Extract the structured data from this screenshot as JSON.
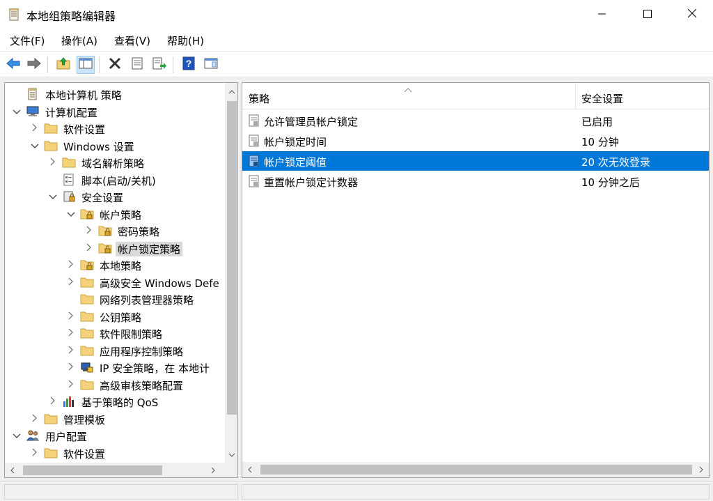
{
  "window": {
    "title": "本地组策略编辑器",
    "controls": {
      "minimize": "minimize-icon",
      "maximize": "maximize-icon",
      "close": "close-icon"
    }
  },
  "menu": [
    "文件(F)",
    "操作(A)",
    "查看(V)",
    "帮助(H)"
  ],
  "toolbar": {
    "icons": [
      "back-arrow-icon",
      "forward-arrow-icon",
      "up-folder-icon",
      "show-hide-tree-icon",
      "delete-icon",
      "properties-icon",
      "export-list-icon",
      "help-icon",
      "console-view-icon"
    ]
  },
  "tree": {
    "items": [
      {
        "label": "本地计算机 策略",
        "icon": "policy-document-icon",
        "expander": "none"
      },
      {
        "label": "计算机配置",
        "icon": "computer-icon",
        "expander": "expanded"
      },
      {
        "label": "软件设置",
        "icon": "folder-icon",
        "expander": "collapsed"
      },
      {
        "label": "Windows 设置",
        "icon": "folder-icon",
        "expander": "expanded"
      },
      {
        "label": "域名解析策略",
        "icon": "folder-icon",
        "expander": "collapsed"
      },
      {
        "label": "脚本(启动/关机)",
        "icon": "script-icon",
        "expander": "none"
      },
      {
        "label": "安全设置",
        "icon": "security-settings-icon",
        "expander": "expanded"
      },
      {
        "label": "帐户策略",
        "icon": "locked-folder-icon",
        "expander": "expanded"
      },
      {
        "label": "密码策略",
        "icon": "locked-folder-icon",
        "expander": "collapsed"
      },
      {
        "label": "帐户锁定策略",
        "icon": "locked-folder-icon",
        "expander": "collapsed",
        "selected": true
      },
      {
        "label": "本地策略",
        "icon": "locked-folder-icon",
        "expander": "collapsed"
      },
      {
        "label": "高级安全 Windows Defe",
        "icon": "folder-icon",
        "expander": "collapsed"
      },
      {
        "label": "网络列表管理器策略",
        "icon": "folder-icon",
        "expander": "none"
      },
      {
        "label": "公钥策略",
        "icon": "folder-icon",
        "expander": "collapsed"
      },
      {
        "label": "软件限制策略",
        "icon": "folder-icon",
        "expander": "collapsed"
      },
      {
        "label": "应用程序控制策略",
        "icon": "folder-icon",
        "expander": "collapsed"
      },
      {
        "label": "IP 安全策略，在 本地计",
        "icon": "ip-security-icon",
        "expander": "collapsed"
      },
      {
        "label": "高级审核策略配置",
        "icon": "folder-icon",
        "expander": "collapsed"
      },
      {
        "label": "基于策略的 QoS",
        "icon": "qos-chart-icon",
        "expander": "collapsed"
      },
      {
        "label": "管理模板",
        "icon": "folder-icon",
        "expander": "collapsed"
      },
      {
        "label": "用户配置",
        "icon": "user-icon",
        "expander": "expanded"
      },
      {
        "label": "软件设置",
        "icon": "folder-icon",
        "expander": "collapsed"
      }
    ]
  },
  "list": {
    "columns": [
      "策略",
      "安全设置"
    ],
    "rows": [
      {
        "policy": "允许管理员帐户锁定",
        "setting": "已启用"
      },
      {
        "policy": "帐户锁定时间",
        "setting": "10 分钟"
      },
      {
        "policy": "帐户锁定阈值",
        "setting": "20 次无效登录",
        "selected": true
      },
      {
        "policy": "重置帐户锁定计数器",
        "setting": "10 分钟之后"
      }
    ]
  },
  "colors": {
    "selection": "#0078d7",
    "tree_selection": "#d9d9d9",
    "folder": "#f4d27a"
  }
}
